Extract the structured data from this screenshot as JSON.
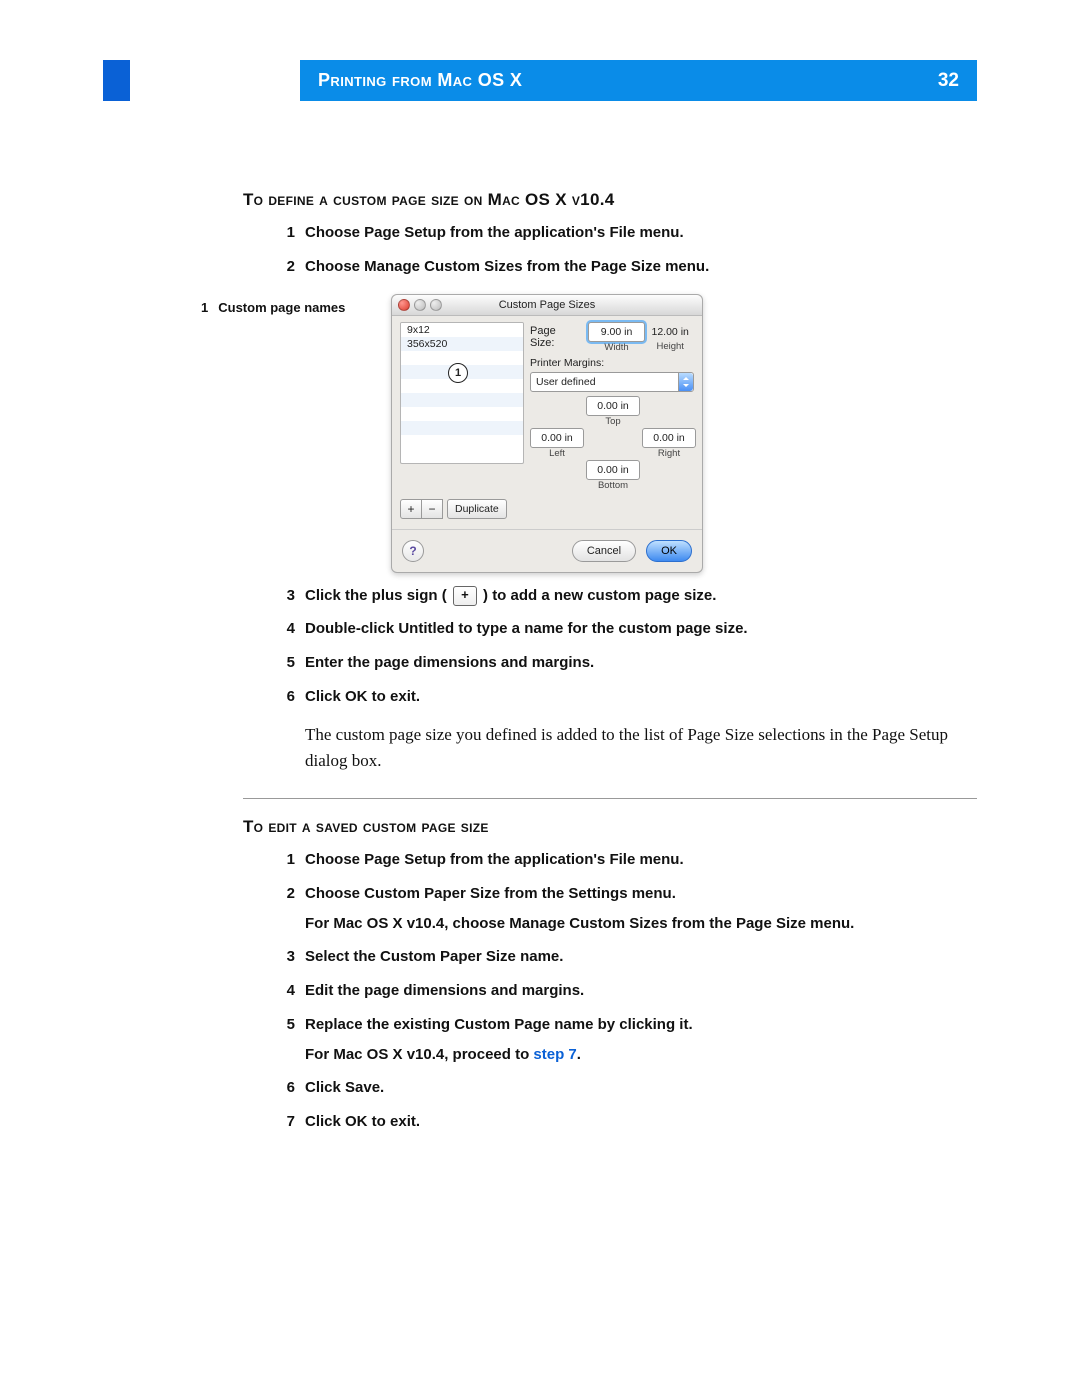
{
  "header": {
    "title": "Printing from Mac OS X",
    "page": "32"
  },
  "section1": {
    "heading": "To define a custom page size on Mac OS X v10.4",
    "steps": [
      "Choose Page Setup from the application's File menu.",
      "Choose Manage Custom Sizes from the Page Size menu."
    ],
    "callout": {
      "num": "1",
      "label": "Custom page names"
    },
    "post_figure_steps": {
      "3_pre": "Click the plus sign ( ",
      "3_post": " ) to add a new custom page size.",
      "4": "Double-click Untitled to type a name for the custom page size.",
      "5": "Enter the page dimensions and margins.",
      "6": "Click OK to exit."
    },
    "paragraph": "The custom page size you defined is added to the list of Page Size selections in the Page Setup dialog box."
  },
  "dialog": {
    "title": "Custom Page Sizes",
    "list": [
      "9x12",
      "356x520"
    ],
    "page_size_label": "Page Size:",
    "width_value": "9.00 in",
    "height_value": "12.00 in",
    "width_label": "Width",
    "height_label": "Height",
    "printer_margins_label": "Printer Margins:",
    "margins_select": "User defined",
    "margin_value": "0.00 in",
    "top_label": "Top",
    "left_label": "Left",
    "right_label": "Right",
    "bottom_label": "Bottom",
    "plus": "+",
    "minus": "−",
    "duplicate": "Duplicate",
    "ok": "OK",
    "cancel": "Cancel",
    "help": "?"
  },
  "section2": {
    "heading": "To edit a saved custom page size",
    "steps": {
      "1": "Choose Page Setup from the application's File menu.",
      "2": "Choose Custom Paper Size from the Settings menu.",
      "2_sub": "For Mac OS X v10.4, choose Manage Custom Sizes from the Page Size menu.",
      "3": "Select the Custom Paper Size name.",
      "4": "Edit the page dimensions and margins.",
      "5": "Replace the existing Custom Page name by clicking it.",
      "5_sub_pre": "For Mac OS X v10.4, proceed to ",
      "5_sub_link": "step 7",
      "5_sub_post": ".",
      "6": "Click Save.",
      "7": "Click OK to exit."
    }
  }
}
